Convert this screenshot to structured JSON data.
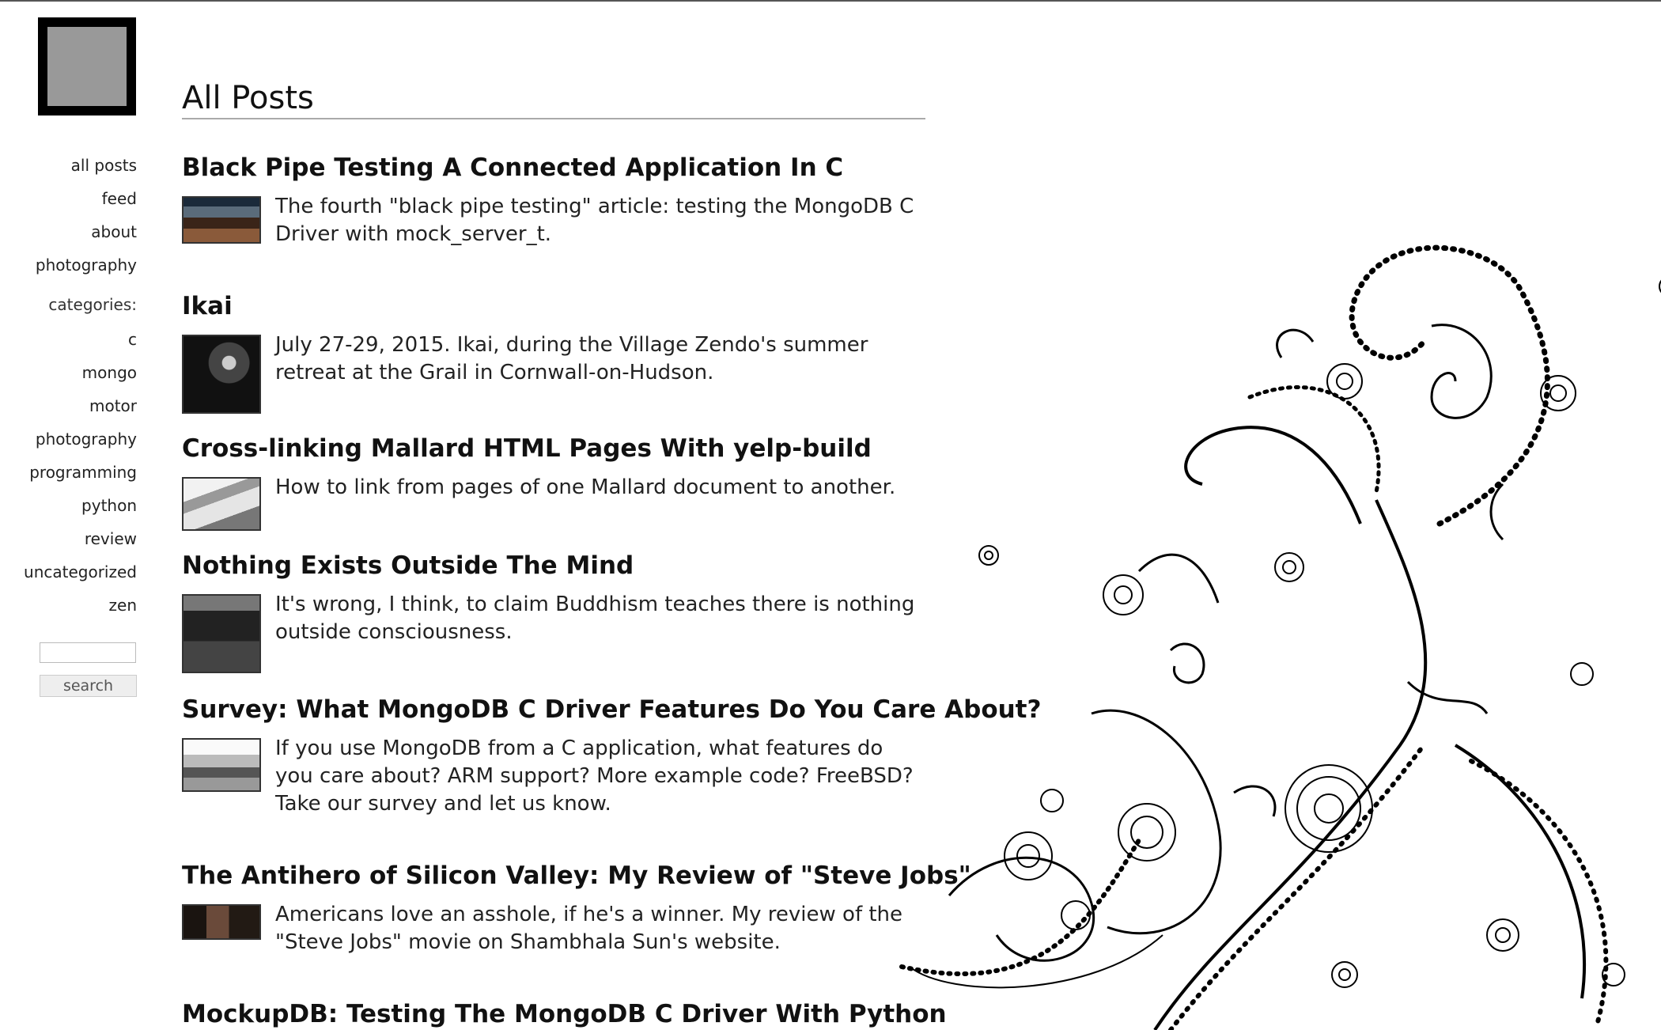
{
  "sidebar": {
    "links": [
      "all posts",
      "feed",
      "about",
      "photography"
    ],
    "categories_label": "categories:",
    "categories": [
      "c",
      "mongo",
      "motor",
      "photography",
      "programming",
      "python",
      "review",
      "uncategorized",
      "zen"
    ],
    "search_value": "",
    "search_button": "search"
  },
  "page": {
    "title": "All Posts"
  },
  "posts": [
    {
      "title": "Black Pipe Testing A Connected Application In C",
      "excerpt": "The fourth \"black pipe testing\" article: testing the MongoDB C Driver with mock_server_t."
    },
    {
      "title": "Ikai",
      "excerpt": "July 27-29, 2015. Ikai, during the Village Zendo's summer retreat at the Grail in Cornwall-on-Hudson."
    },
    {
      "title": "Cross-linking Mallard HTML Pages With yelp-build",
      "excerpt": "How to link from pages of one Mallard document to another."
    },
    {
      "title": "Nothing Exists Outside The Mind",
      "excerpt": "It's wrong, I think, to claim Buddhism teaches there is nothing outside consciousness."
    },
    {
      "title": "Survey: What MongoDB C Driver Features Do You Care About?",
      "excerpt": "If you use MongoDB from a C application, what features do you care about? ARM support? More example code? FreeBSD? Take our survey and let us know."
    },
    {
      "title": "The Antihero of Silicon Valley: My Review of \"Steve Jobs\"",
      "excerpt": "Americans love an asshole, if he's a winner. My review of the \"Steve Jobs\" movie on Shambhala Sun's website."
    },
    {
      "title": "MockupDB: Testing The MongoDB C Driver With Python",
      "excerpt": ""
    }
  ]
}
